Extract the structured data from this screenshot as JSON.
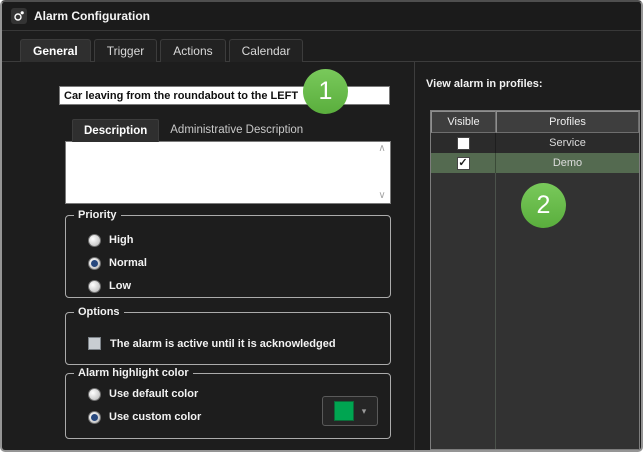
{
  "window": {
    "title": "Alarm Configuration"
  },
  "tabs": [
    {
      "label": "General",
      "active": true
    },
    {
      "label": "Trigger",
      "active": false
    },
    {
      "label": "Actions",
      "active": false
    },
    {
      "label": "Calendar",
      "active": false
    }
  ],
  "alarm_name": {
    "value": "Car leaving from the roundabout to the LEFT"
  },
  "annotations": {
    "step1": "1",
    "step2": "2"
  },
  "description": {
    "tabs": [
      {
        "label": "Description",
        "active": true
      },
      {
        "label": "Administrative Description",
        "active": false
      }
    ],
    "text": ""
  },
  "priority": {
    "legend": "Priority",
    "options": [
      {
        "label": "High",
        "selected": false
      },
      {
        "label": "Normal",
        "selected": true
      },
      {
        "label": "Low",
        "selected": false
      }
    ]
  },
  "options": {
    "legend": "Options",
    "acknowledge_label": "The alarm is active until it is acknowledged",
    "acknowledge_checked": false
  },
  "highlight_color": {
    "legend": "Alarm highlight color",
    "options": [
      {
        "label": "Use default color",
        "selected": false
      },
      {
        "label": "Use custom color",
        "selected": true
      }
    ],
    "custom_color": "#00a551"
  },
  "profiles_panel": {
    "label": "View alarm in profiles:",
    "columns": [
      "Visible",
      "Profiles"
    ],
    "rows": [
      {
        "profile": "Service",
        "visible": false,
        "highlighted": false
      },
      {
        "profile": "Demo",
        "visible": true,
        "highlighted": true
      }
    ]
  },
  "icons": {
    "scroll_up": "∧",
    "scroll_down": "∨",
    "dropdown_arrow": "▾",
    "check_mark": "✓"
  },
  "colors": {
    "annotation_green": "#6abf47",
    "row_highlight_green": "#546a50",
    "custom_swatch_green": "#00a551",
    "radio_selected_blue": "#27487e"
  }
}
